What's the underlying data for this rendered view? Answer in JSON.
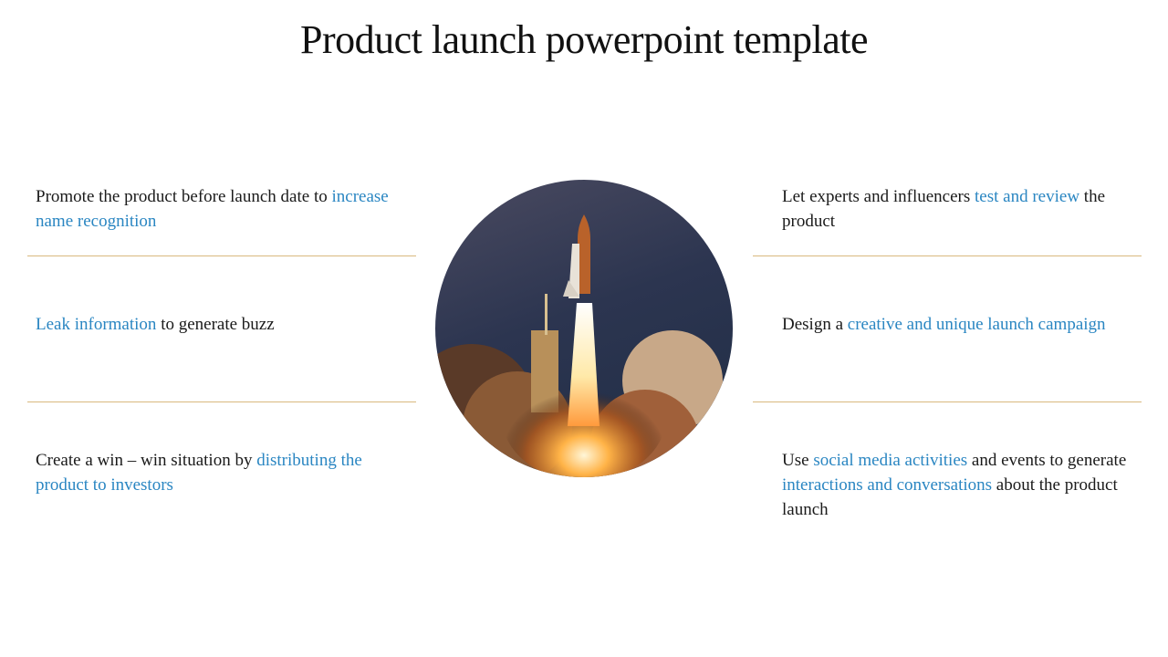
{
  "title": "Product launch powerpoint template",
  "colors": {
    "highlight": "#2a86c2",
    "divider": "#d9b97e",
    "text": "#1a1a1a"
  },
  "left": [
    {
      "parts": [
        {
          "t": "Promote the product before launch date to ",
          "hl": false
        },
        {
          "t": "increase name recognition",
          "hl": true
        }
      ]
    },
    {
      "parts": [
        {
          "t": "Leak information",
          "hl": true
        },
        {
          "t": " to generate buzz",
          "hl": false
        }
      ]
    },
    {
      "parts": [
        {
          "t": "Create a win – win situation by ",
          "hl": false
        },
        {
          "t": "distributing the product to investors",
          "hl": true
        }
      ]
    }
  ],
  "right": [
    {
      "parts": [
        {
          "t": "Let experts and influencers ",
          "hl": false
        },
        {
          "t": "test and review",
          "hl": true
        },
        {
          "t": " the product",
          "hl": false
        }
      ]
    },
    {
      "parts": [
        {
          "t": "Design a ",
          "hl": false
        },
        {
          "t": "creative and unique launch campaign",
          "hl": true
        }
      ]
    },
    {
      "parts": [
        {
          "t": "Use ",
          "hl": false
        },
        {
          "t": "social media activities",
          "hl": true
        },
        {
          "t": " and events  to generate ",
          "hl": false
        },
        {
          "t": "interactions and conversations",
          "hl": true
        },
        {
          "t": " about the product launch",
          "hl": false
        }
      ]
    }
  ],
  "image": {
    "description": "space-shuttle-launch-photo"
  }
}
